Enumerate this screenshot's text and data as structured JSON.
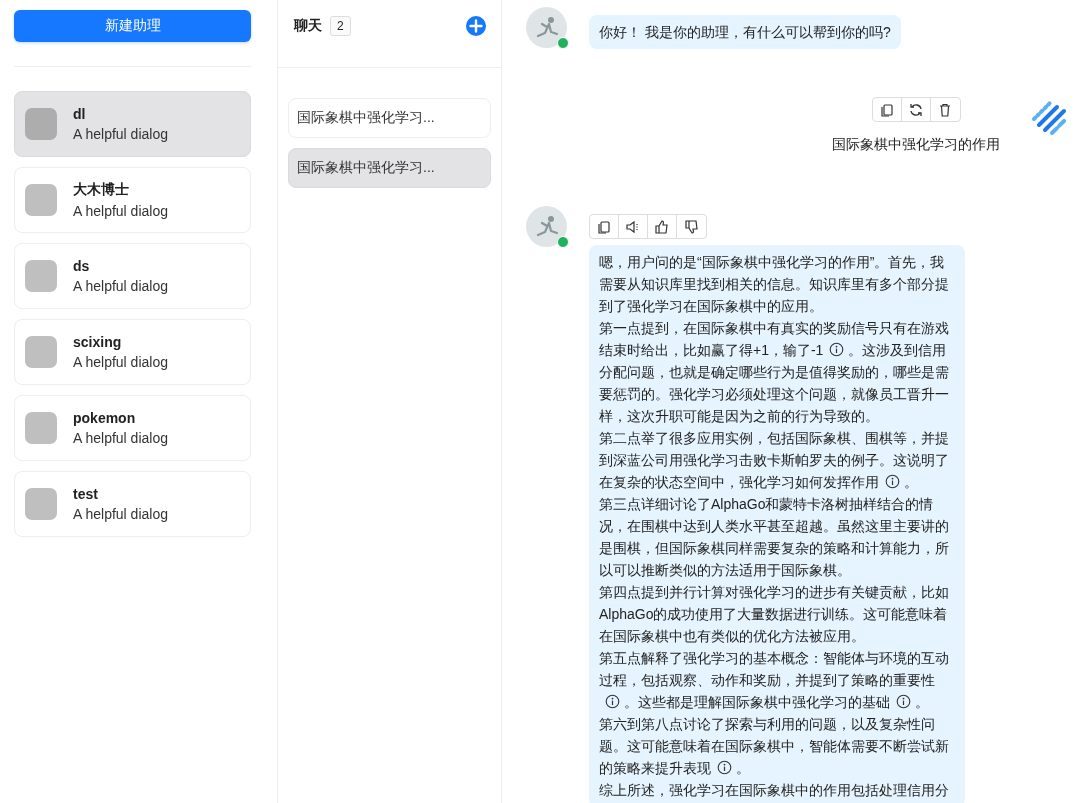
{
  "assistants_panel": {
    "new_button": "新建助理",
    "assistants": [
      {
        "name": "dl",
        "description": "A helpful dialog",
        "selected": true
      },
      {
        "name": "大木博士",
        "description": "A helpful dialog",
        "selected": false
      },
      {
        "name": "ds",
        "description": "A helpful dialog",
        "selected": false
      },
      {
        "name": "scixing",
        "description": "A helpful dialog",
        "selected": false
      },
      {
        "name": "pokemon",
        "description": "A helpful dialog",
        "selected": false
      },
      {
        "name": "test",
        "description": "A helpful dialog",
        "selected": false
      }
    ]
  },
  "chats_panel": {
    "title": "聊天",
    "count": "2",
    "chats": [
      {
        "title": "国际象棋中强化学习...",
        "selected": false
      },
      {
        "title": "国际象棋中强化学习...",
        "selected": true
      }
    ]
  },
  "messages": [
    {
      "kind": "assistant",
      "online": true,
      "paragraphs": [
        [
          {
            "kind": "text",
            "text": "你好！ 我是你的助理，有什么可以帮到你的吗?"
          }
        ]
      ]
    },
    {
      "kind": "user",
      "actions": [
        {
          "kind": "copy"
        },
        {
          "kind": "regenerate"
        },
        {
          "kind": "delete"
        }
      ],
      "paragraphs": [
        [
          {
            "kind": "text",
            "text": "国际象棋中强化学习的作用"
          }
        ]
      ]
    },
    {
      "kind": "assistant",
      "online": true,
      "actions": [
        {
          "kind": "copy"
        },
        {
          "kind": "read_aloud"
        },
        {
          "kind": "like"
        },
        {
          "kind": "dislike"
        }
      ],
      "paragraphs": [
        [
          {
            "kind": "text",
            "text": "嗯，用户问的是“国际象棋中强化学习的作用”。首先，我需要从知识库里找到相关的信息。知识库里有多个部分提到了强化学习在国际象棋中的应用。"
          }
        ],
        [
          {
            "kind": "text",
            "text": "第一点提到，在国际象棋中有真实的奖励信号只有在游戏结束时给出，比如赢了得+1，输了-1"
          },
          {
            "kind": "info"
          },
          {
            "kind": "text",
            "text": "。这涉及到信用分配问题，也就是确定哪些行为是值得奖励的，哪些是需要惩罚的。强化学习必须处理这个问题，就像员工晋升一样，这次升职可能是因为之前的行为导致的。"
          }
        ],
        [
          {
            "kind": "text",
            "text": "第二点举了很多应用实例，包括国际象棋、围棋等，并提到深蓝公司用强化学习击败卡斯帕罗夫的例子。这说明了在复杂的状态空间中，强化学习如何发挥作用"
          },
          {
            "kind": "info"
          },
          {
            "kind": "text",
            "text": "。"
          }
        ],
        [
          {
            "kind": "text",
            "text": "第三点详细讨论了AlphaGo和蒙特卡洛树抽样结合的情况，在围棋中达到人类水平甚至超越。虽然这里主要讲的是围棋，但国际象棋同样需要复杂的策略和计算能力，所以可以推断类似的方法适用于国际象棋。"
          }
        ],
        [
          {
            "kind": "text",
            "text": "第四点提到并行计算对强化学习的进步有关键贡献，比如AlphaGo的成功使用了大量数据进行训练。这可能意味着在国际象棋中也有类似的优化方法被应用。"
          }
        ],
        [
          {
            "kind": "text",
            "text": "第五点解释了强化学习的基本概念：智能体与环境的互动过程，包括观察、动作和奖励，并提到了策略的重要性"
          },
          {
            "kind": "info"
          },
          {
            "kind": "text",
            "text": "。这些都是理解国际象棋中强化学习的基础"
          },
          {
            "kind": "info"
          },
          {
            "kind": "text",
            "text": "。"
          }
        ],
        [
          {
            "kind": "text",
            "text": "第六到第八点讨论了探索与利用的问题，以及复杂性问题。这可能意味着在国际象棋中，智能体需要不断尝试新的策略来提升表现"
          },
          {
            "kind": "info"
          },
          {
            "kind": "text",
            "text": "。"
          }
        ],
        [
          {
            "kind": "text",
            "text": "综上所述，强化学习在国际象棋中的作用包括处理信用分"
          }
        ]
      ]
    }
  ]
}
